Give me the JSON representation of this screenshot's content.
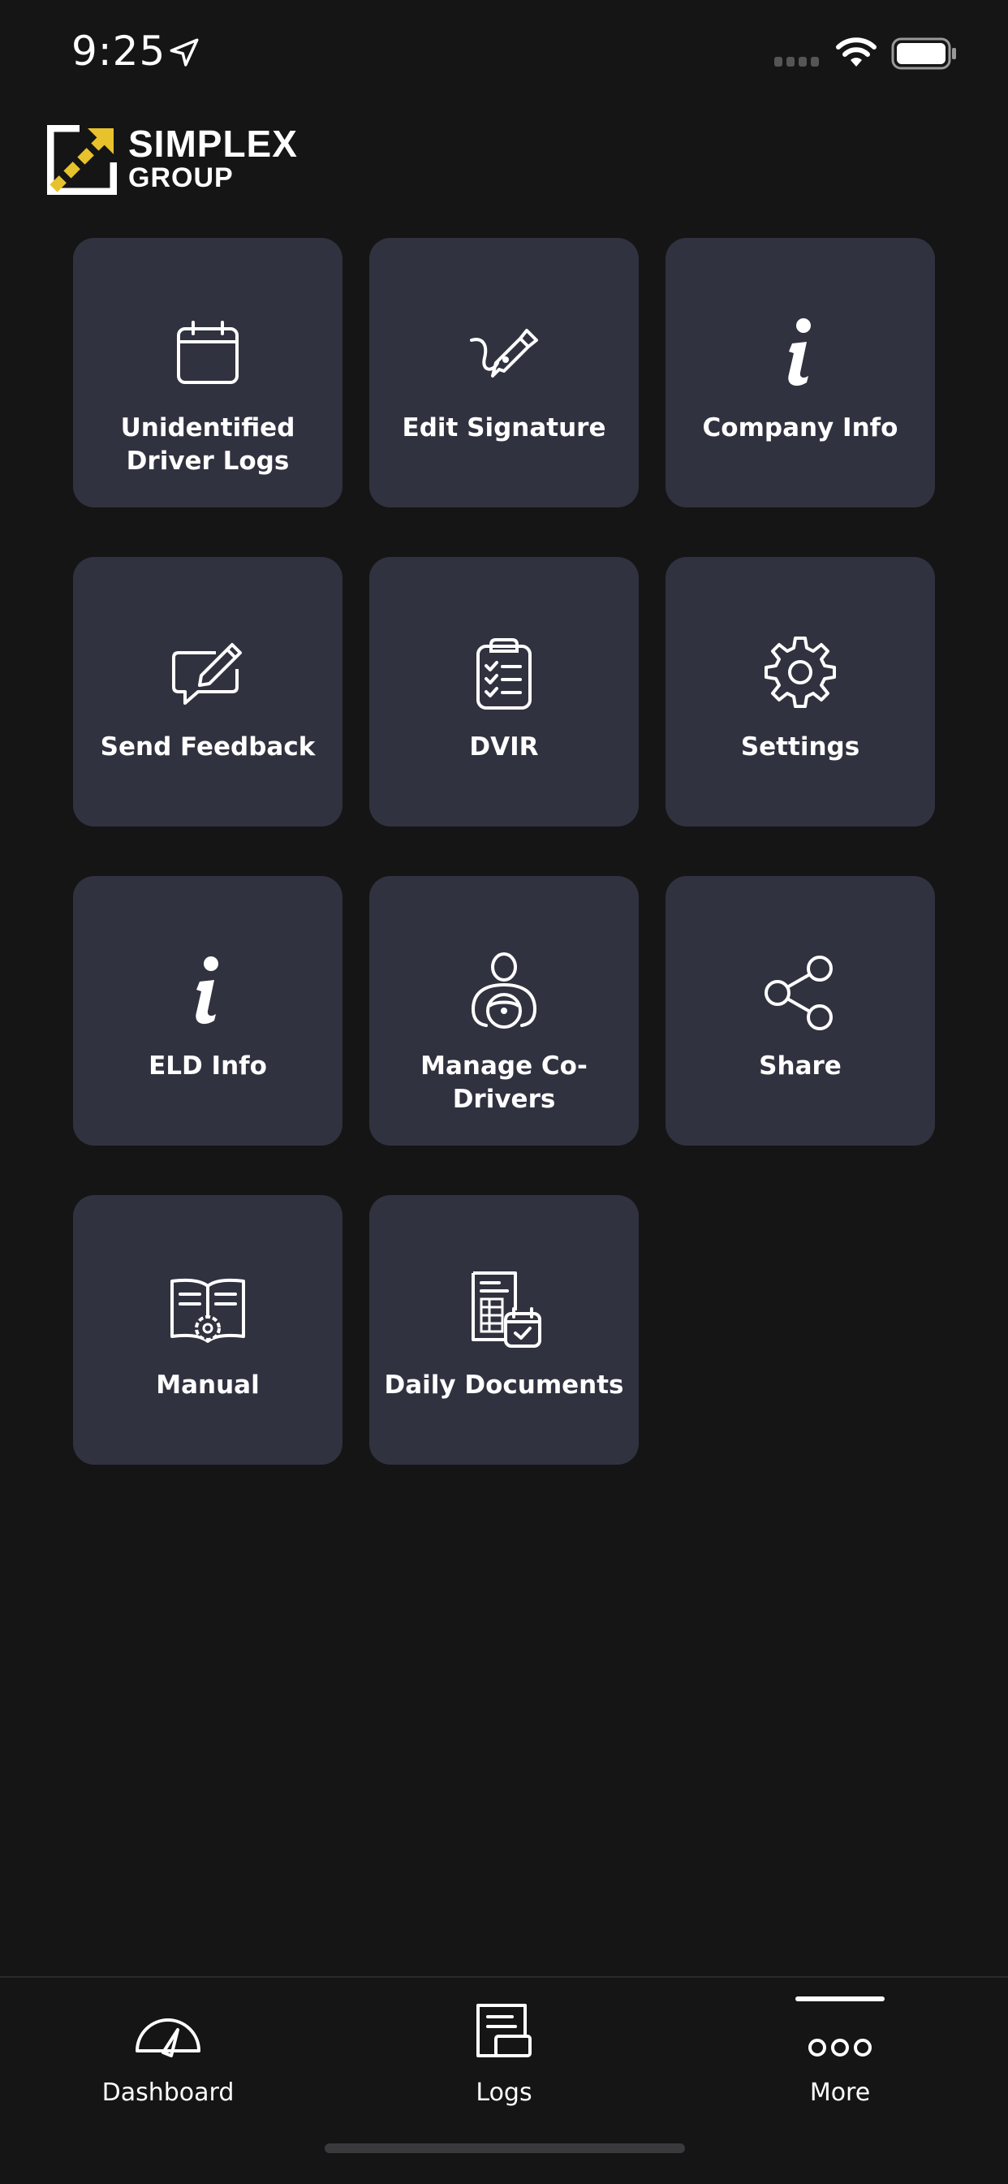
{
  "status_bar": {
    "time": "9:25"
  },
  "brand": {
    "line1": "SIMPLEX",
    "line2": "GROUP",
    "accent_color": "#e8c22d"
  },
  "tiles": [
    {
      "label": "Unidentified Driver Logs",
      "icon": "calendar-icon"
    },
    {
      "label": "Edit Signature",
      "icon": "signature-pen-icon"
    },
    {
      "label": "Company Info",
      "icon": "info-icon"
    },
    {
      "label": "Send Feedback",
      "icon": "feedback-icon"
    },
    {
      "label": "DVIR",
      "icon": "clipboard-checklist-icon"
    },
    {
      "label": "Settings",
      "icon": "gear-icon"
    },
    {
      "label": "ELD Info",
      "icon": "info-icon"
    },
    {
      "label": "Manage Co-Drivers",
      "icon": "driver-icon"
    },
    {
      "label": "Share",
      "icon": "share-icon"
    },
    {
      "label": "Manual",
      "icon": "manual-book-icon"
    },
    {
      "label": "Daily Documents",
      "icon": "documents-calendar-icon"
    }
  ],
  "tabbar": {
    "items": [
      {
        "label": "Dashboard",
        "icon": "speedometer-icon"
      },
      {
        "label": "Logs",
        "icon": "logs-icon"
      },
      {
        "label": "More",
        "icon": "more-dots-icon",
        "selected": true
      }
    ]
  },
  "colors": {
    "background": "#151516",
    "tile": "#31323f",
    "text": "#ffffff"
  }
}
